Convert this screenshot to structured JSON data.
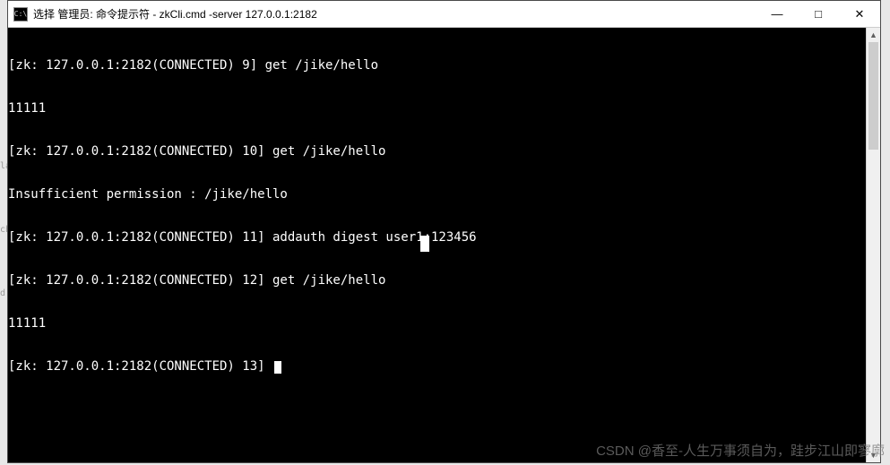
{
  "window": {
    "icon_glyph": "C:\\",
    "title": "选择 管理员: 命令提示符 - zkCli.cmd  -server 127.0.0.1:2182",
    "controls": {
      "min": "—",
      "max": "□",
      "close": "✕"
    }
  },
  "terminal": {
    "lines": [
      "[zk: 127.0.0.1:2182(CONNECTED) 9] get /jike/hello",
      "11111",
      "[zk: 127.0.0.1:2182(CONNECTED) 10] get /jike/hello",
      "Insufficient permission : /jike/hello",
      "[zk: 127.0.0.1:2182(CONNECTED) 11] addauth digest user1:123456",
      "[zk: 127.0.0.1:2182(CONNECTED) 12] get /jike/hello",
      "11111",
      "[zk: 127.0.0.1:2182(CONNECTED) 13] "
    ]
  },
  "left_fragments": {
    "a": "la",
    "b": "ch",
    "c": "d"
  },
  "watermark": "CSDN @香至-人生万事须自为，跬步江山即寥廓"
}
